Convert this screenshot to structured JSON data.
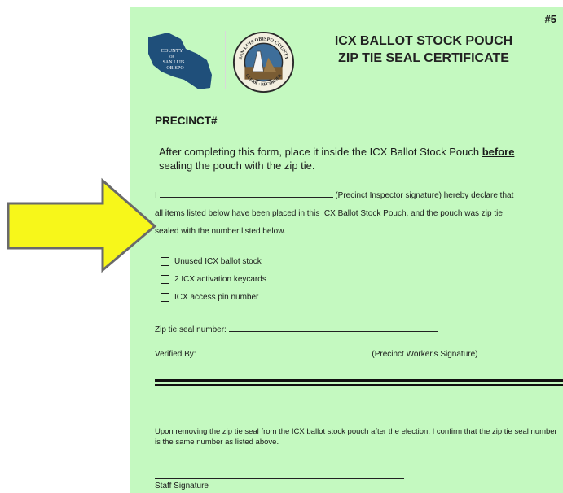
{
  "page_number": "#5",
  "logos": {
    "county": {
      "lines": [
        "COUNTY",
        "OF",
        "SAN LUIS",
        "OBISPO"
      ]
    },
    "seal": {
      "top_text": "SAN LUIS OBISPO COUNTY",
      "bottom_text": "CLERK · RECORDER"
    }
  },
  "title": {
    "line1": "ICX BALLOT STOCK POUCH",
    "line2": "ZIP TIE SEAL CERTIFICATE"
  },
  "precinct_label": "PRECINCT#",
  "instruction": {
    "before": "After completing this form, place it inside the ICX Ballot Stock Pouch ",
    "emphasis": "before",
    "after": " sealing the pouch with the zip tie."
  },
  "declaration": {
    "prefix": "I",
    "suffix": "(Precinct Inspector signature) hereby declare that",
    "line2": "all items listed below have been placed in this ICX Ballot Stock Pouch, and the pouch was zip tie",
    "line3": "sealed with the number listed below."
  },
  "checklist": [
    {
      "label": "Unused ICX ballot stock",
      "checked": false
    },
    {
      "label": "2 ICX activation keycards",
      "checked": false
    },
    {
      "label": "ICX access pin number",
      "checked": false
    }
  ],
  "zip_label": "Zip tie seal number:",
  "verified": {
    "label": "Verified By:",
    "suffix": "(Precinct Worker's Signature)"
  },
  "confirm_text": "Upon removing the zip tie seal from the ICX ballot stock pouch after the election, I confirm that the zip tie seal number is the same number as listed above.",
  "staff_signature_label": "Staff Signature",
  "colors": {
    "document_background": "#c4f9c0",
    "arrow_fill": "#f7f71a",
    "arrow_stroke": "#6a6a6a",
    "county_logo": "#1f4f7a"
  }
}
